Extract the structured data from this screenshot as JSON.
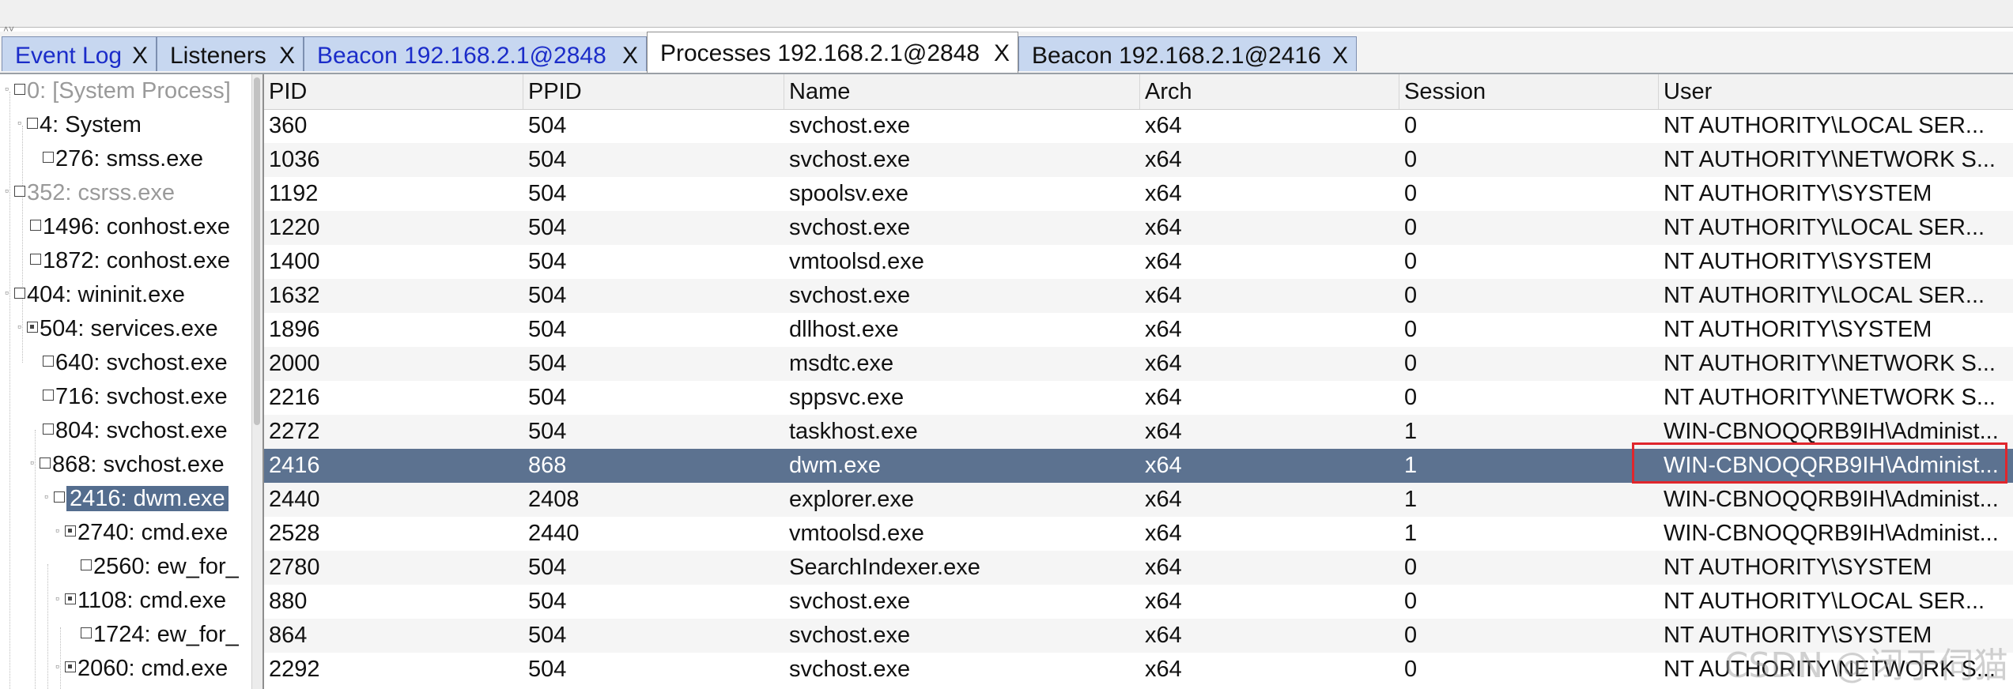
{
  "tabs": [
    {
      "label": "Event Log",
      "close": "X",
      "style": "blue"
    },
    {
      "label": "Listeners",
      "close": "X",
      "style": "normal"
    },
    {
      "label": "Beacon 192.168.2.1@2848",
      "close": "X",
      "style": "blue"
    },
    {
      "label": "Processes 192.168.2.1@2848",
      "close": "X",
      "style": "active"
    },
    {
      "label": "Beacon 192.168.2.1@2416",
      "close": "X",
      "style": "normal"
    }
  ],
  "tree": [
    {
      "label": "0: [System Process]",
      "gray": true
    },
    {
      "label": "4: System",
      "gray": false
    },
    {
      "label": "276: smss.exe",
      "gray": false
    },
    {
      "label": "352: csrss.exe",
      "gray": true
    },
    {
      "label": "1496: conhost.exe",
      "gray": false
    },
    {
      "label": "1872: conhost.exe",
      "gray": false
    },
    {
      "label": "404: wininit.exe",
      "gray": false
    },
    {
      "label": "504: services.exe",
      "gray": false
    },
    {
      "label": "640: svchost.exe",
      "gray": false
    },
    {
      "label": "716: svchost.exe",
      "gray": false
    },
    {
      "label": "804: svchost.exe",
      "gray": false
    },
    {
      "label": "868: svchost.exe",
      "gray": false
    },
    {
      "label": "2416: dwm.exe",
      "gray": false
    },
    {
      "label": "2740: cmd.exe",
      "gray": false
    },
    {
      "label": "2560: ew_for_",
      "gray": false
    },
    {
      "label": "1108: cmd.exe",
      "gray": false
    },
    {
      "label": "1724: ew_for_",
      "gray": false
    },
    {
      "label": "2060: cmd.exe",
      "gray": false
    }
  ],
  "table": {
    "columns": [
      "PID",
      "PPID",
      "Name",
      "Arch",
      "Session",
      "User"
    ],
    "rows": [
      [
        "360",
        "504",
        "svchost.exe",
        "x64",
        "0",
        "NT AUTHORITY\\LOCAL SER..."
      ],
      [
        "1036",
        "504",
        "svchost.exe",
        "x64",
        "0",
        "NT AUTHORITY\\NETWORK S..."
      ],
      [
        "1192",
        "504",
        "spoolsv.exe",
        "x64",
        "0",
        "NT AUTHORITY\\SYSTEM"
      ],
      [
        "1220",
        "504",
        "svchost.exe",
        "x64",
        "0",
        "NT AUTHORITY\\LOCAL SER..."
      ],
      [
        "1400",
        "504",
        "vmtoolsd.exe",
        "x64",
        "0",
        "NT AUTHORITY\\SYSTEM"
      ],
      [
        "1632",
        "504",
        "svchost.exe",
        "x64",
        "0",
        "NT AUTHORITY\\LOCAL SER..."
      ],
      [
        "1896",
        "504",
        "dllhost.exe",
        "x64",
        "0",
        "NT AUTHORITY\\SYSTEM"
      ],
      [
        "2000",
        "504",
        "msdtc.exe",
        "x64",
        "0",
        "NT AUTHORITY\\NETWORK S..."
      ],
      [
        "2216",
        "504",
        "sppsvc.exe",
        "x64",
        "0",
        "NT AUTHORITY\\NETWORK S..."
      ],
      [
        "2272",
        "504",
        "taskhost.exe",
        "x64",
        "1",
        "WIN-CBNOQQRB9IH\\Administ..."
      ],
      [
        "2416",
        "868",
        "dwm.exe",
        "x64",
        "1",
        "WIN-CBNOQQRB9IH\\Administ..."
      ],
      [
        "2440",
        "2408",
        "explorer.exe",
        "x64",
        "1",
        "WIN-CBNOQQRB9IH\\Administ..."
      ],
      [
        "2528",
        "2440",
        "vmtoolsd.exe",
        "x64",
        "1",
        "WIN-CBNOQQRB9IH\\Administ..."
      ],
      [
        "2780",
        "504",
        "SearchIndexer.exe",
        "x64",
        "0",
        "NT AUTHORITY\\SYSTEM"
      ],
      [
        "880",
        "504",
        "svchost.exe",
        "x64",
        "0",
        "NT AUTHORITY\\LOCAL SER..."
      ],
      [
        "864",
        "504",
        "svchost.exe",
        "x64",
        "0",
        "NT AUTHORITY\\SYSTEM"
      ],
      [
        "2292",
        "504",
        "svchost.exe",
        "x64",
        "0",
        "NT AUTHORITY\\NETWORK S..."
      ]
    ],
    "selected_pid": "2416"
  },
  "watermark": "CSDN @闭于伺猫",
  "colors": {
    "selection": "#5c7290",
    "tab_inactive": "#c7d7f0",
    "highlight_box": "#e0262c",
    "link_blue": "#1b2cc9"
  }
}
